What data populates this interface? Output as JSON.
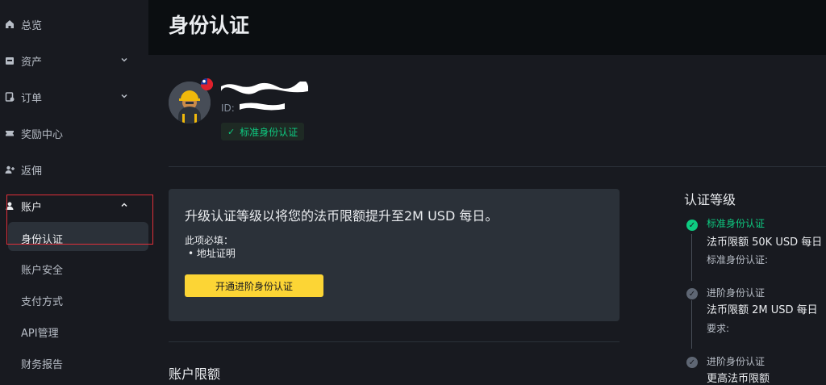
{
  "sidebar": {
    "items": [
      {
        "label": "总览",
        "icon": "home-icon"
      },
      {
        "label": "资产",
        "icon": "wallet-icon"
      },
      {
        "label": "订单",
        "icon": "orders-icon"
      },
      {
        "label": "奖励中心",
        "icon": "ticket-icon"
      },
      {
        "label": "返佣",
        "icon": "add-user-icon"
      },
      {
        "label": "账户",
        "icon": "user-icon"
      }
    ],
    "account_sub": [
      {
        "label": "身份认证"
      },
      {
        "label": "账户安全"
      },
      {
        "label": "支付方式"
      },
      {
        "label": "API管理"
      },
      {
        "label": "财务报告"
      }
    ]
  },
  "header": {
    "title": "身份认证"
  },
  "profile": {
    "id_label": "ID:",
    "badge": "标准身份认证"
  },
  "upgrade_card": {
    "title": "升级认证等级以将您的法币限额提升至2M USD 每日。",
    "required_label": "此项必填：",
    "required_item": "•  地址证明",
    "button": "开通进阶身份认证"
  },
  "account_limits_title": "账户限额",
  "verification_levels": {
    "title": "认证等级",
    "levels": [
      {
        "name": "标准身份认证",
        "limit": "法币限额 50K USD 每日",
        "sub": "标准身份认证:",
        "status": "done"
      },
      {
        "name": "进阶身份认证",
        "limit": "法币限额 2M USD 每日",
        "sub": "要求:",
        "status": "pending"
      },
      {
        "name": "进阶身份认证",
        "limit": "更高法币限额",
        "sub": "",
        "status": "pending"
      }
    ]
  },
  "colors": {
    "accent_yellow": "#FCD535",
    "success_green": "#0ECB81",
    "highlight_red": "#E02F3A"
  }
}
